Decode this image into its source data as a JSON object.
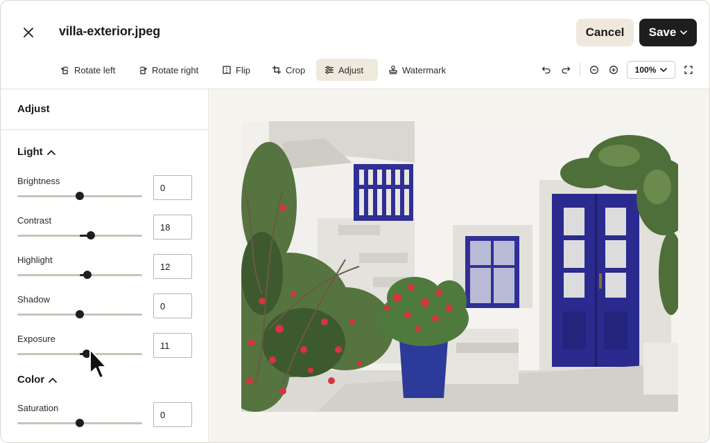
{
  "header": {
    "file_name": "villa-exterior.jpeg",
    "cancel_label": "Cancel",
    "save_label": "Save"
  },
  "toolbar": {
    "tools": [
      {
        "label": "Rotate left",
        "icon": "rotate-left-icon"
      },
      {
        "label": "Rotate right",
        "icon": "rotate-right-icon"
      },
      {
        "label": "Flip",
        "icon": "flip-icon"
      },
      {
        "label": "Crop",
        "icon": "crop-icon"
      },
      {
        "label": "Adjust",
        "icon": "sliders-icon",
        "active": true
      },
      {
        "label": "Watermark",
        "icon": "stamp-icon"
      }
    ],
    "zoom": "100%"
  },
  "sidebar": {
    "title": "Adjust",
    "sections": [
      {
        "title": "Light",
        "expanded": true,
        "controls": [
          {
            "label": "Brightness",
            "value": "0",
            "level": 0
          },
          {
            "label": "Contrast",
            "value": "18",
            "level": 18
          },
          {
            "label": "Highlight",
            "value": "12",
            "level": 12
          },
          {
            "label": "Shadow",
            "value": "0",
            "level": 0
          },
          {
            "label": "Exposure",
            "value": "11",
            "level": 11
          }
        ]
      },
      {
        "title": "Color",
        "expanded": true,
        "controls": [
          {
            "label": "Saturation",
            "value": "0",
            "level": 0
          }
        ]
      }
    ],
    "slider_range": [
      -100,
      100
    ]
  },
  "colors": {
    "accent_beige": "#efe9dd",
    "dark": "#1e1e1e",
    "canvas_bg": "#f6f4ef",
    "door_blue": "#2a2a8f"
  }
}
